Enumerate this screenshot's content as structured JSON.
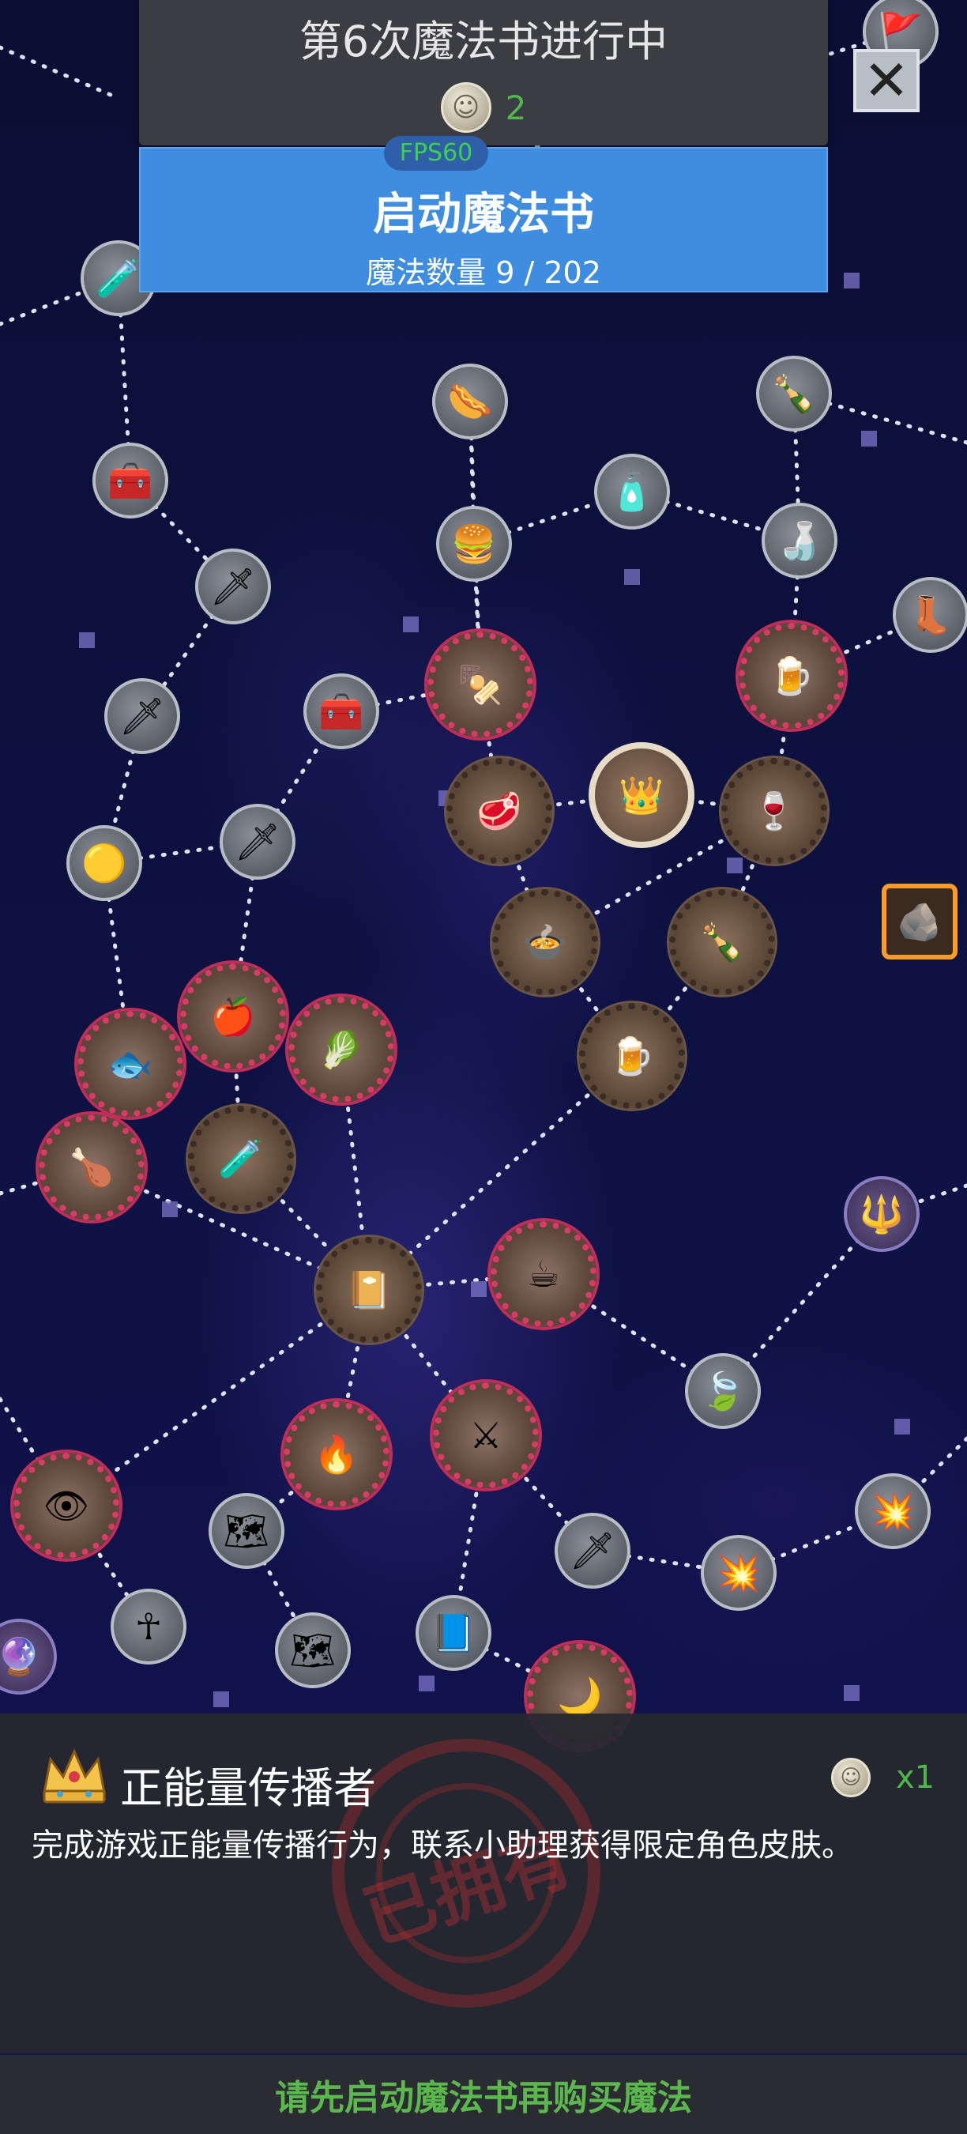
{
  "header": {
    "book_title": "第6次魔法书进行中",
    "coin_count": "2",
    "fps": "FPS60",
    "start_button": "启动魔法书",
    "spell_count": "魔法数量 9 / 202"
  },
  "close_button": {
    "icon": "close-icon"
  },
  "map_nodes": [
    {
      "icon": "potion-green-icon",
      "glyph": "🧪"
    },
    {
      "icon": "crown-chest-icon",
      "glyph": "🧰"
    },
    {
      "icon": "hotdog-icon",
      "glyph": "🌭"
    },
    {
      "icon": "blue-potion-icon",
      "glyph": "🧴"
    },
    {
      "icon": "wine-bottle-icon",
      "glyph": "🍾"
    },
    {
      "icon": "hamburger-icon",
      "glyph": "🍔"
    },
    {
      "icon": "liquor-bottle-icon",
      "glyph": "🍶"
    },
    {
      "icon": "sword-icon",
      "glyph": "🗡"
    },
    {
      "icon": "treasure-chest-icon",
      "glyph": "🧰"
    },
    {
      "icon": "kebab-icon",
      "glyph": "🍢"
    },
    {
      "icon": "beer-icon",
      "glyph": "🍺"
    },
    {
      "icon": "dagger-icon",
      "glyph": "🗡"
    },
    {
      "icon": "steak-icon",
      "glyph": "🥩"
    },
    {
      "icon": "crown-icon",
      "glyph": "👑"
    },
    {
      "icon": "red-wine-icon",
      "glyph": "🍷"
    },
    {
      "icon": "slime-icon",
      "glyph": "🟡"
    },
    {
      "icon": "red-sword-icon",
      "glyph": "🗡"
    },
    {
      "icon": "soup-icon",
      "glyph": "🍲"
    },
    {
      "icon": "green-bottle-icon",
      "glyph": "🍾"
    },
    {
      "icon": "apple-icon",
      "glyph": "🍎"
    },
    {
      "icon": "fish-icon",
      "glyph": "🐟"
    },
    {
      "icon": "cabbage-icon",
      "glyph": "🥬"
    },
    {
      "icon": "ale-mug-icon",
      "glyph": "🍺"
    },
    {
      "icon": "roast-chicken-icon",
      "glyph": "🍗"
    },
    {
      "icon": "mana-potion-icon",
      "glyph": "🧪"
    },
    {
      "icon": "spellbook-icon",
      "glyph": "📔"
    },
    {
      "icon": "coffee-icon",
      "glyph": "☕"
    },
    {
      "icon": "leaf-icon",
      "glyph": "🍃"
    },
    {
      "icon": "torch-icon",
      "glyph": "🔥"
    },
    {
      "icon": "crossed-swords-icon",
      "glyph": "⚔"
    },
    {
      "icon": "dragon-eye-icon",
      "glyph": "👁"
    },
    {
      "icon": "scroll-map-icon",
      "glyph": "🗺"
    },
    {
      "icon": "flame-sword-icon",
      "glyph": "🗡"
    },
    {
      "icon": "explosion-sword-icon",
      "glyph": "💥"
    },
    {
      "icon": "fire-burst-icon",
      "glyph": "💥"
    },
    {
      "icon": "ankh-bag-icon",
      "glyph": "☥"
    },
    {
      "icon": "treasure-map-icon",
      "glyph": "🗺"
    },
    {
      "icon": "tome-icon",
      "glyph": "📘"
    },
    {
      "icon": "moon-icon",
      "glyph": "🌙"
    },
    {
      "icon": "coal-icon",
      "glyph": "🪨"
    },
    {
      "icon": "wizard-boots-icon",
      "glyph": "👢"
    },
    {
      "icon": "pitchfork-icon",
      "glyph": "🔱"
    },
    {
      "icon": "banner-icon",
      "glyph": "🚩"
    },
    {
      "icon": "purple-orb-icon",
      "glyph": "🔮"
    }
  ],
  "item": {
    "icon": "crown-icon",
    "name": "正能量传播者",
    "price_qty": "x1",
    "description": "完成游戏正能量传播行为，联系小助理获得限定角色皮肤。",
    "owned_stamp": "已拥有"
  },
  "buy_bar": {
    "label": "请先启动魔法书再购买魔法"
  },
  "colors": {
    "start_button_bg": "#3e8de0",
    "coin_count": "#4fb84a",
    "fps_text": "#3bd24a",
    "buy_label": "#5cb84e",
    "rare_border": "#d73b66",
    "legendary_border": "#ff9a22"
  }
}
